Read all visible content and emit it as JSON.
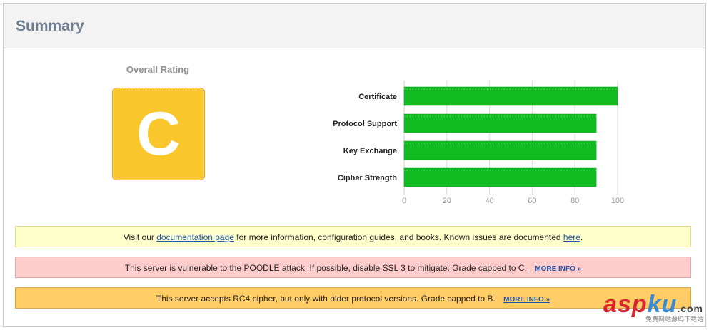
{
  "header": {
    "title": "Summary"
  },
  "rating": {
    "label": "Overall Rating",
    "grade": "C",
    "grade_color": "#f9c62b"
  },
  "chart_data": {
    "type": "bar",
    "orientation": "horizontal",
    "categories": [
      "Certificate",
      "Protocol Support",
      "Key Exchange",
      "Cipher Strength"
    ],
    "values": [
      100,
      90,
      90,
      90
    ],
    "xlim": [
      0,
      100
    ],
    "ticks": [
      "0",
      "20",
      "40",
      "60",
      "80",
      "100"
    ],
    "bar_color": "#11bb22",
    "grid": true
  },
  "notices": {
    "doc": {
      "prefix": "Visit our ",
      "link1": "documentation page",
      "middle": " for more information, configuration guides, and books. Known issues are documented ",
      "link2": "here",
      "suffix": "."
    },
    "poodle": {
      "text": "This server is vulnerable to the POODLE attack. If possible, disable SSL 3 to mitigate. Grade capped to C.",
      "more": "MORE INFO »"
    },
    "rc4": {
      "text": "This server accepts RC4 cipher, but only with older protocol versions. Grade capped to B.",
      "more": "MORE INFO »"
    }
  },
  "watermark": {
    "part1": "asp",
    "part2": "ku",
    "tld": ".com",
    "sub": "免费网站源码下载站"
  }
}
